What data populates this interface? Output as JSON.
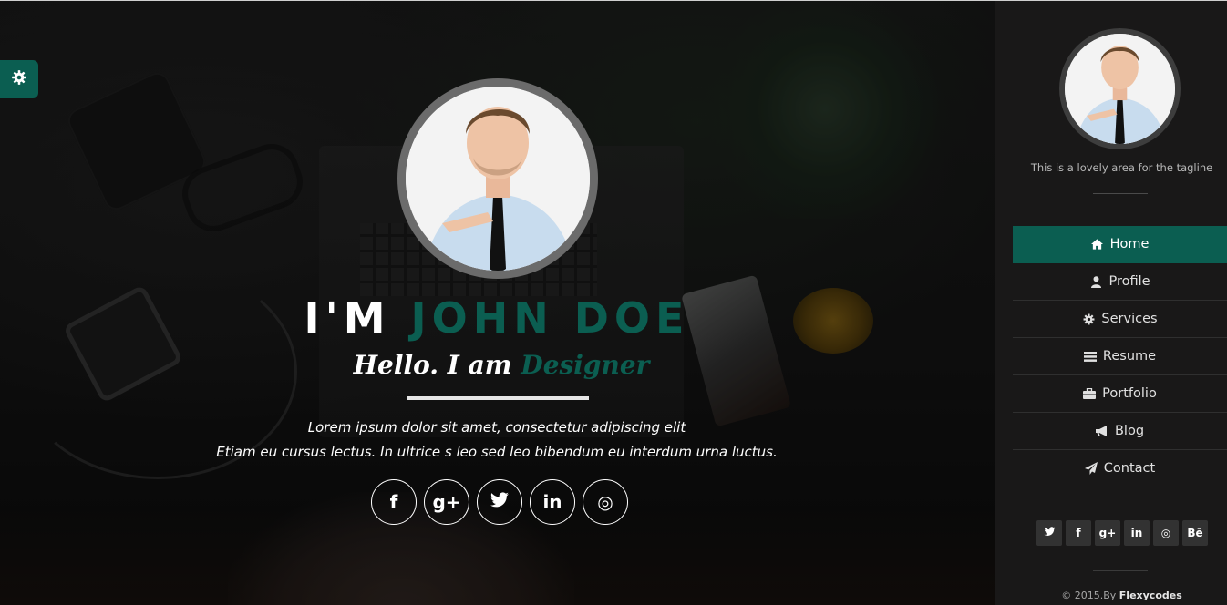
{
  "colors": {
    "accent": "#0b5e51",
    "sidebar_bg": "#191818",
    "text": "#ffffff"
  },
  "hero": {
    "title_prefix": "I'M ",
    "title_name": "JOHN DOE",
    "sub_prefix": "Hello. I am",
    "sub_role": "Designer",
    "line1": "Lorem ipsum dolor sit amet, consectetur adipiscing elit",
    "line2": "Etiam eu cursus lectus. In ultrice s leo sed leo bibendum eu interdum urna luctus.",
    "social": [
      {
        "icon": "facebook-icon",
        "glyph": "f"
      },
      {
        "icon": "google-plus-icon",
        "glyph": "g+"
      },
      {
        "icon": "twitter-icon",
        "glyph": "t"
      },
      {
        "icon": "linkedin-icon",
        "glyph": "in"
      },
      {
        "icon": "dribbble-icon",
        "glyph": "◎"
      }
    ]
  },
  "sidebar": {
    "tagline": "This is a lovely area for the tagline",
    "menu": [
      {
        "label": "Home",
        "icon": "home-icon",
        "active": true
      },
      {
        "label": "Profile",
        "icon": "user-icon",
        "active": false
      },
      {
        "label": "Services",
        "icon": "gear-icon",
        "active": false
      },
      {
        "label": "Resume",
        "icon": "list-icon",
        "active": false
      },
      {
        "label": "Portfolio",
        "icon": "briefcase-icon",
        "active": false
      },
      {
        "label": "Blog",
        "icon": "megaphone-icon",
        "active": false
      },
      {
        "label": "Contact",
        "icon": "paper-plane-icon",
        "active": false
      }
    ],
    "social": [
      {
        "icon": "twitter-icon",
        "glyph": "t"
      },
      {
        "icon": "facebook-icon",
        "glyph": "f"
      },
      {
        "icon": "google-plus-icon",
        "glyph": "g+"
      },
      {
        "icon": "linkedin-icon",
        "glyph": "in"
      },
      {
        "icon": "dribbble-icon",
        "glyph": "◎"
      },
      {
        "icon": "behance-icon",
        "glyph": "Bē"
      }
    ],
    "copyright_prefix": "© 2015.By ",
    "copyright_brand": "Flexycodes"
  }
}
